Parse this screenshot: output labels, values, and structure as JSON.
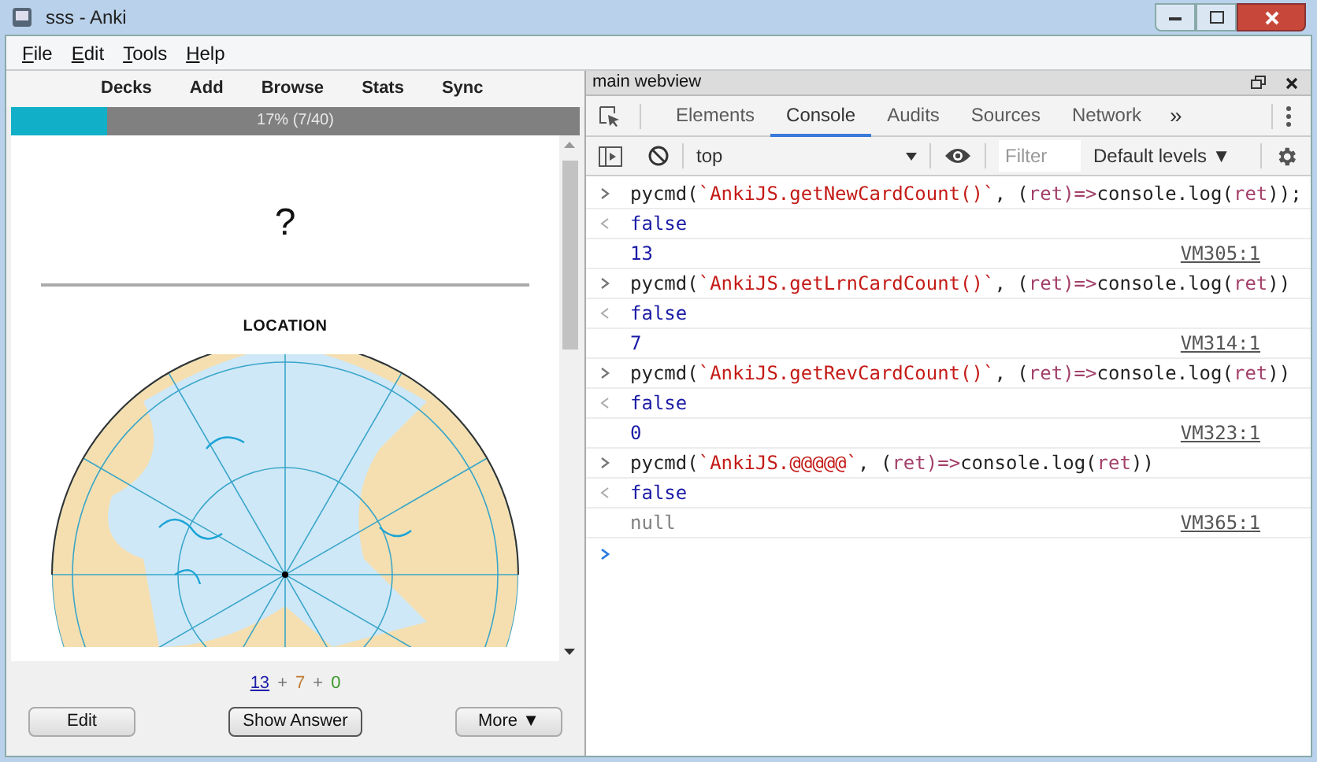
{
  "window": {
    "title": "sss - Anki"
  },
  "menu": [
    "File",
    "Edit",
    "Tools",
    "Help"
  ],
  "toolbar": [
    "Decks",
    "Add",
    "Browse",
    "Stats",
    "Sync"
  ],
  "progress": {
    "level": 0.17,
    "label": "17% (7/40)"
  },
  "card": {
    "question": "?",
    "heading": "LOCATION"
  },
  "counts": {
    "items": [
      {
        "value": "13",
        "color": "#1e1ea8",
        "underlined": true
      },
      {
        "value": "7",
        "color": "#c07a30",
        "underlined": false
      },
      {
        "value": "0",
        "color": "#3a9a2a",
        "underlined": false
      }
    ],
    "separator": "+"
  },
  "buttons": [
    {
      "label": "Edit",
      "focused": false
    },
    {
      "label": "Show Answer",
      "focused": true
    },
    {
      "label": "More ▼",
      "focused": false
    }
  ],
  "devtools": {
    "title": "main webview",
    "tabs": [
      {
        "label": "Elements",
        "selected": false
      },
      {
        "label": "Console",
        "selected": true
      },
      {
        "label": "Audits",
        "selected": false
      },
      {
        "label": "Sources",
        "selected": false
      },
      {
        "label": "Network",
        "selected": false
      }
    ],
    "more_tabs": "»",
    "context": "top",
    "filter": {
      "placeholder": "Filter"
    },
    "levels": "Default levels ▼",
    "console": [
      {
        "kind": "input",
        "parts": [
          {
            "kind": "plain",
            "text": "pycmd("
          },
          {
            "kind": "string",
            "text": "`AnkiJS.getNewCardCount()`"
          },
          {
            "kind": "plain",
            "text": ", ("
          },
          {
            "kind": "param",
            "text": "ret"
          },
          {
            "kind": "arrow",
            "text": ")=>"
          },
          {
            "kind": "plain",
            "text": "console.log("
          },
          {
            "kind": "param",
            "text": "ret"
          },
          {
            "kind": "plain",
            "text": "));"
          }
        ]
      },
      {
        "kind": "return",
        "text": "false"
      },
      {
        "kind": "number",
        "text": "13",
        "source": "VM305:1"
      },
      {
        "kind": "input",
        "parts": [
          {
            "kind": "plain",
            "text": "pycmd("
          },
          {
            "kind": "string",
            "text": "`AnkiJS.getLrnCardCount()`"
          },
          {
            "kind": "plain",
            "text": ", ("
          },
          {
            "kind": "param",
            "text": "ret"
          },
          {
            "kind": "arrow",
            "text": ")=>"
          },
          {
            "kind": "plain",
            "text": "console.log("
          },
          {
            "kind": "param",
            "text": "ret"
          },
          {
            "kind": "plain",
            "text": "))"
          }
        ]
      },
      {
        "kind": "return",
        "text": "false"
      },
      {
        "kind": "number",
        "text": "7",
        "source": "VM314:1"
      },
      {
        "kind": "input",
        "parts": [
          {
            "kind": "plain",
            "text": "pycmd("
          },
          {
            "kind": "string",
            "text": "`AnkiJS.getRevCardCount()`"
          },
          {
            "kind": "plain",
            "text": ", ("
          },
          {
            "kind": "param",
            "text": "ret"
          },
          {
            "kind": "arrow",
            "text": ")=>"
          },
          {
            "kind": "plain",
            "text": "console.log("
          },
          {
            "kind": "param",
            "text": "ret"
          },
          {
            "kind": "plain",
            "text": "))"
          }
        ]
      },
      {
        "kind": "return",
        "text": "false"
      },
      {
        "kind": "number",
        "text": "0",
        "source": "VM323:1"
      },
      {
        "kind": "input",
        "parts": [
          {
            "kind": "plain",
            "text": "pycmd("
          },
          {
            "kind": "string",
            "text": "`AnkiJS.@@@@@`"
          },
          {
            "kind": "plain",
            "text": ", ("
          },
          {
            "kind": "param",
            "text": "ret"
          },
          {
            "kind": "arrow",
            "text": ")=>"
          },
          {
            "kind": "plain",
            "text": "console.log("
          },
          {
            "kind": "param",
            "text": "ret"
          },
          {
            "kind": "plain",
            "text": "))"
          }
        ]
      },
      {
        "kind": "return",
        "text": "false"
      },
      {
        "kind": "null",
        "text": "null",
        "source": "VM365:1"
      },
      {
        "kind": "prompt"
      }
    ]
  }
}
